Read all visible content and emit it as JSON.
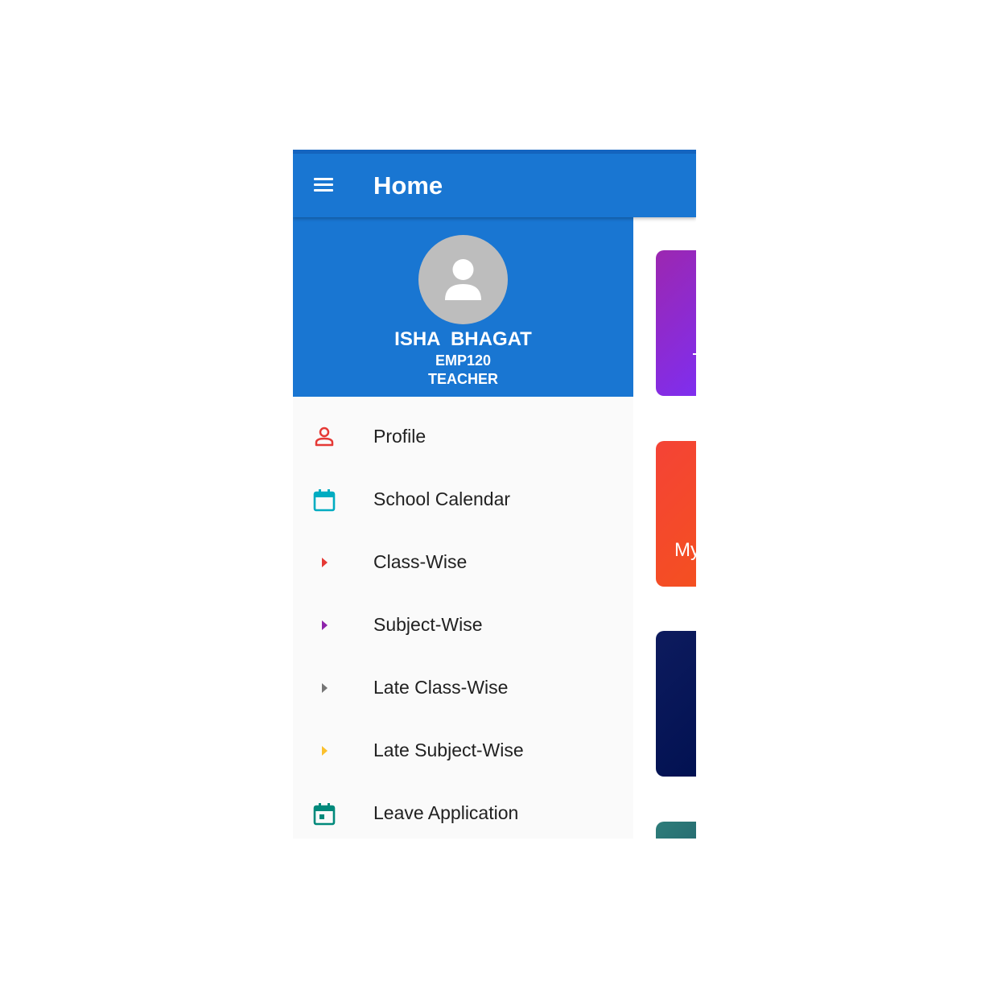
{
  "appbar": {
    "title": "Home",
    "color": "#1976d2"
  },
  "user": {
    "name": "ISHA  BHAGAT",
    "id": "EMP120",
    "role": "TEACHER"
  },
  "menu": [
    {
      "label": "Profile",
      "icon": "person-icon",
      "color": "#e53935"
    },
    {
      "label": "School Calendar",
      "icon": "calendar-icon",
      "color": "#00acc1"
    },
    {
      "label": "Class-Wise",
      "icon": "arrow-right-icon",
      "color": "#e53935"
    },
    {
      "label": "Subject-Wise",
      "icon": "arrow-right-icon",
      "color": "#8e24aa"
    },
    {
      "label": "Late Class-Wise",
      "icon": "arrow-right-icon",
      "color": "#757575"
    },
    {
      "label": "Late Subject-Wise",
      "icon": "arrow-right-icon",
      "color": "#fbc02d"
    },
    {
      "label": "Leave Application",
      "icon": "event-icon",
      "color": "#00897b"
    }
  ],
  "background_cards": [
    {
      "text": "",
      "colors": [
        "#9c27b0",
        "#7b2ff7"
      ]
    },
    {
      "text": "My",
      "colors": [
        "#f44336",
        "#f4511e"
      ]
    },
    {
      "text": "",
      "colors": [
        "#0d1b5e",
        "#001050"
      ]
    },
    {
      "text": "",
      "colors": [
        "#2e7d7a",
        "#1f5f6a"
      ]
    }
  ]
}
